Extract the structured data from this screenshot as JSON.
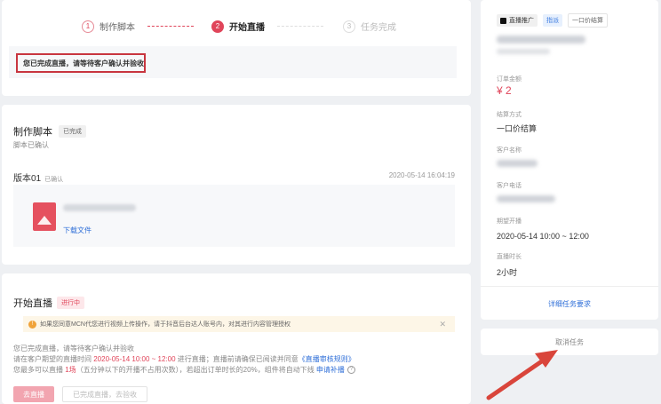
{
  "steps": [
    {
      "num": "1",
      "label": "制作脚本",
      "state": "done"
    },
    {
      "num": "2",
      "label": "开始直播",
      "state": "active"
    },
    {
      "num": "3",
      "label": "任务完成",
      "state": "todo"
    }
  ],
  "notice": "您已完成直播，请等待客户确认并验收",
  "script_section": {
    "title": "制作脚本",
    "badge": "已完成",
    "subtitle": "脚本已确认",
    "version": "版本01",
    "version_status": "已确认",
    "version_time": "2020-05-14 16:04:19",
    "download_label": "下载文件"
  },
  "live_section": {
    "title": "开始直播",
    "badge": "进行中",
    "warning": "如果您同意MCN代您进行视频上传操作，请于抖音后台达人账号内，对其进行内容管理授权",
    "line1": "您已完成直播，请等待客户确认并验收",
    "line2_pre": "请在客户期望的直播时间 ",
    "line2_time": "2020-05-14 10:00 ~ 12:00",
    "line2_mid": " 进行直播；直播前请确保已阅读并同意",
    "line2_link": "《直播审核规则》",
    "line3_pre": "您最多可以直播 ",
    "line3_count": "1场",
    "line3_mid": "（五分钟以下的开播不占用次数），若超出订单时长的20%，组件将自动下线 ",
    "line3_link": "申请补播",
    "live_button": "去直播",
    "done_button": "已完成直播，去验收"
  },
  "sidebar": {
    "platform_tag": "直播推广",
    "type_tag": "指派",
    "settle_tag": "一口价结算",
    "amount_label": "订单金额",
    "amount": "¥ 2",
    "settle_label": "结算方式",
    "settle_value": "一口价结算",
    "client_name_label": "客户名称",
    "client_phone_label": "客户电话",
    "time_label": "期望开播",
    "time_value": "2020-05-14 10:00 ~ 12:00",
    "duration_label": "直播时长",
    "duration_value": "2小时",
    "detail_link": "详细任务要求",
    "cancel_button": "取消任务"
  },
  "colors": {
    "accent": "#e0455a",
    "link": "#2f6fd8",
    "highlight_box": "#c8353f",
    "arrow": "#d9453b"
  }
}
